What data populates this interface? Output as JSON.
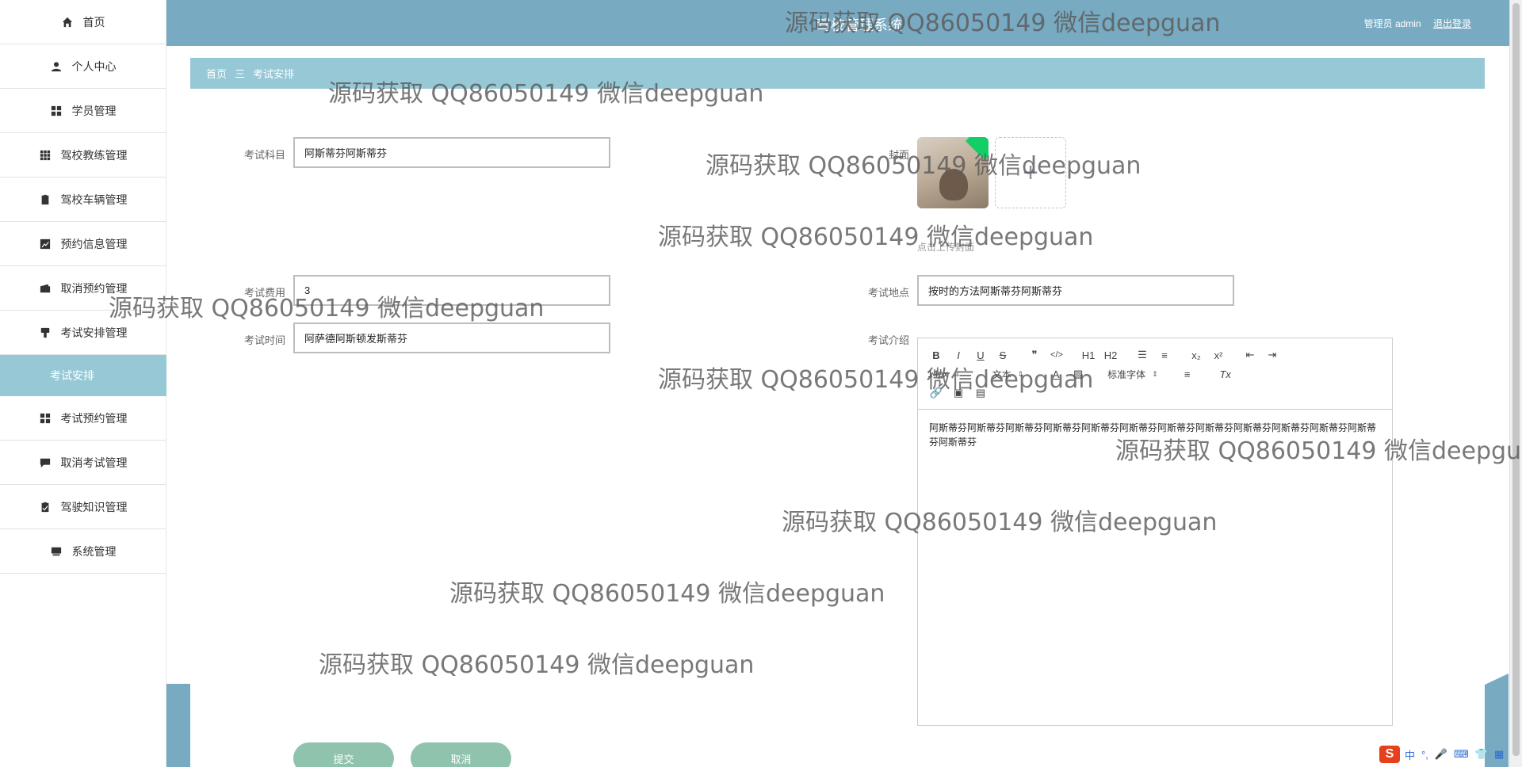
{
  "header": {
    "title": "驾校管理系统",
    "user_text": "管理员 admin",
    "logout_label": "退出登录"
  },
  "sidebar": {
    "items": [
      {
        "label": "首页",
        "icon": "home-icon"
      },
      {
        "label": "个人中心",
        "icon": "user-icon"
      },
      {
        "label": "学员管理",
        "icon": "grid-icon"
      },
      {
        "label": "驾校教练管理",
        "icon": "apps-icon"
      },
      {
        "label": "驾校车辆管理",
        "icon": "clipboard-icon"
      },
      {
        "label": "预约信息管理",
        "icon": "chart-icon"
      },
      {
        "label": "取消预约管理",
        "icon": "wallet-icon"
      },
      {
        "label": "考试安排管理",
        "icon": "award-icon"
      },
      {
        "label": "考试预约管理",
        "icon": "grid-icon"
      },
      {
        "label": "取消考试管理",
        "icon": "message-icon"
      },
      {
        "label": "驾驶知识管理",
        "icon": "checklist-icon"
      },
      {
        "label": "系统管理",
        "icon": "monitor-icon"
      }
    ],
    "active_sub": "考试安排"
  },
  "breadcrumb": {
    "home": "首页",
    "separator": "三",
    "current": "考试安排"
  },
  "form": {
    "subject": {
      "label": "考试科目",
      "value": "阿斯蒂芬阿斯蒂芬"
    },
    "cover": {
      "label": "封面",
      "tip": "点击上传封面"
    },
    "fee": {
      "label": "考试费用",
      "value": "3"
    },
    "location": {
      "label": "考试地点",
      "value": "按时的方法阿斯蒂芬阿斯蒂芬"
    },
    "time": {
      "label": "考试时间",
      "value": "阿萨德阿斯顿发斯蒂芬"
    },
    "intro": {
      "label": "考试介绍",
      "content": "阿斯蒂芬阿斯蒂芬阿斯蒂芬阿斯蒂芬阿斯蒂芬阿斯蒂芬阿斯蒂芬阿斯蒂芬阿斯蒂芬阿斯蒂芬阿斯蒂芬阿斯蒂芬阿斯蒂芬"
    }
  },
  "editor_toolbar": {
    "bold": "B",
    "italic": "I",
    "underline": "U",
    "strike": "S",
    "quote": "❞",
    "code": "</>",
    "h1": "H1",
    "h2": "H2",
    "sub": "x₂",
    "sup": "x²",
    "size_select": "14px",
    "text_select": "文本",
    "font_select": "标准字体",
    "color": "A"
  },
  "buttons": {
    "submit": "提交",
    "cancel": "取消"
  },
  "watermark": "源码获取 QQ86050149 微信deepguan",
  "ime": {
    "logo": "S",
    "items": [
      "中",
      "°,",
      "🎤",
      "⌨",
      "👕",
      "▦"
    ]
  }
}
